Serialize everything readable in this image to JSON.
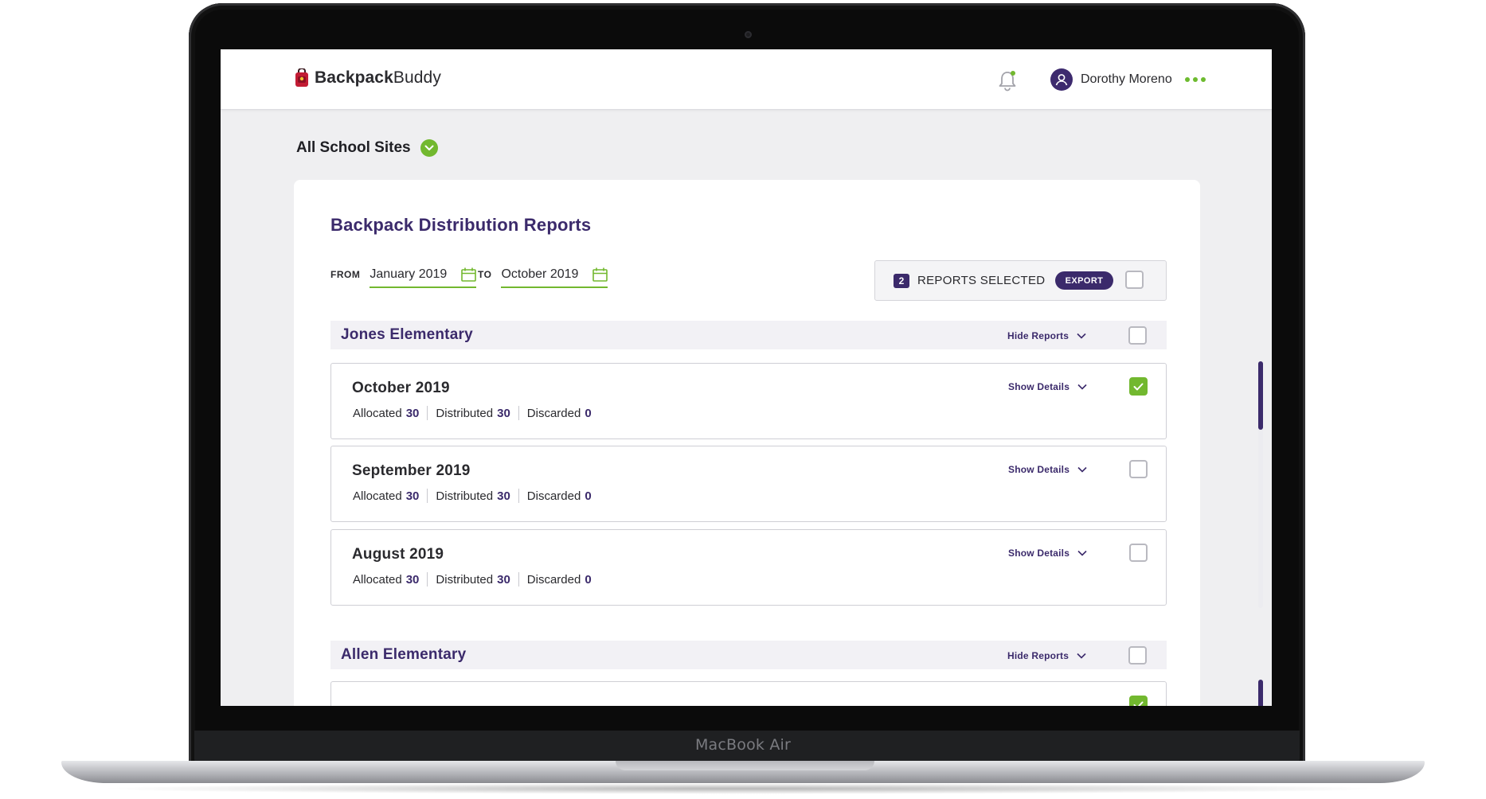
{
  "device": {
    "label": "MacBook Air"
  },
  "header": {
    "logo_part1": "Backpack",
    "logo_part2": "Buddy",
    "user_name": "Dorothy Moreno"
  },
  "site_selector": {
    "label": "All School Sites"
  },
  "panel": {
    "title": "Backpack Distribution Reports",
    "from_label": "FROM",
    "from_value": "January 2019",
    "to_label": "TO",
    "to_value": "October 2019",
    "selected_count": "2",
    "selected_label": "REPORTS SELECTED",
    "export_label": "EXPORT"
  },
  "schools": [
    {
      "name": "Jones Elementary",
      "toggle_label": "Hide Reports",
      "reports": [
        {
          "month": "October 2019",
          "toggle_label": "Show Details",
          "allocated_label": "Allocated",
          "allocated": "30",
          "distributed_label": "Distributed",
          "distributed": "30",
          "discarded_label": "Discarded",
          "discarded": "0",
          "checked": true
        },
        {
          "month": "September 2019",
          "toggle_label": "Show Details",
          "allocated_label": "Allocated",
          "allocated": "30",
          "distributed_label": "Distributed",
          "distributed": "30",
          "discarded_label": "Discarded",
          "discarded": "0",
          "checked": false
        },
        {
          "month": "August 2019",
          "toggle_label": "Show Details",
          "allocated_label": "Allocated",
          "allocated": "30",
          "distributed_label": "Distributed",
          "distributed": "30",
          "discarded_label": "Discarded",
          "discarded": "0",
          "checked": false
        }
      ]
    },
    {
      "name": "Allen Elementary",
      "toggle_label": "Hide Reports"
    }
  ],
  "colors": {
    "brand_purple": "#3b2a6b",
    "accent_green": "#72b82f"
  }
}
